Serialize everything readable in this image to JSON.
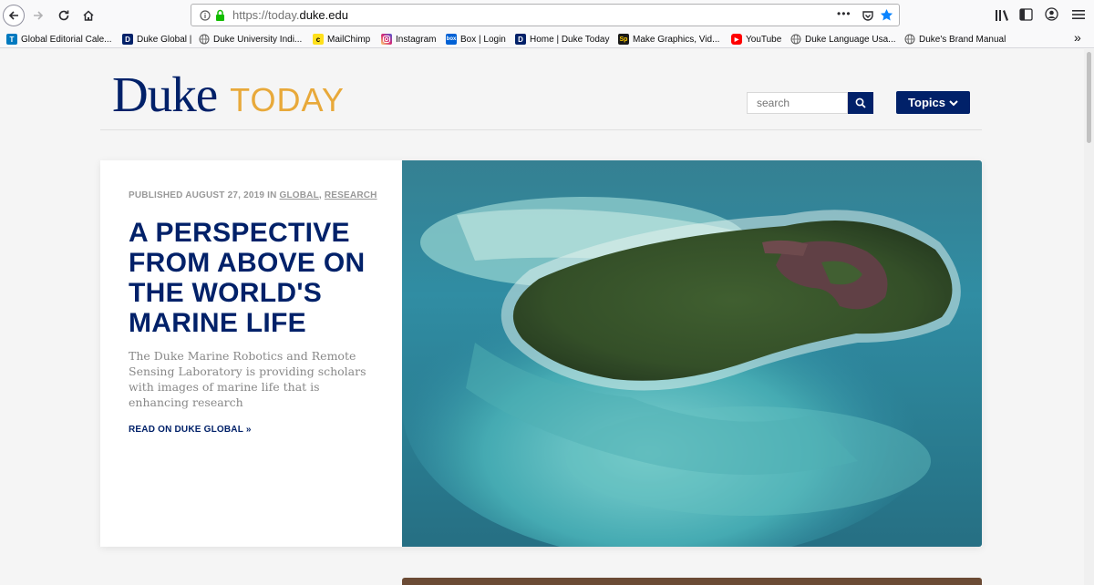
{
  "browser": {
    "url_prefix": "https://today.",
    "url_domain": "duke.edu",
    "menu_dots": "•••",
    "overflow_chevrons": "»"
  },
  "bookmarks": [
    {
      "label": "Global Editorial Cale...",
      "fav": "T",
      "color": "#0079bf"
    },
    {
      "label": "Duke Global |",
      "fav": "D",
      "color": "#012169"
    },
    {
      "label": "Duke University Indi...",
      "fav": "",
      "color": ""
    },
    {
      "label": "MailChimp",
      "fav": "c",
      "color": "#ffe01b"
    },
    {
      "label": "Instagram",
      "fav": "",
      "color": "#c13584"
    },
    {
      "label": "Box | Login",
      "fav": "box",
      "color": "#0061d5"
    },
    {
      "label": "Home | Duke Today",
      "fav": "D",
      "color": "#012169"
    },
    {
      "label": "Make Graphics, Vid...",
      "fav": "Sp",
      "color": "#1a1a1a"
    },
    {
      "label": "YouTube",
      "fav": "▶",
      "color": "#ff0000"
    },
    {
      "label": "Duke Language Usa...",
      "fav": "",
      "color": ""
    },
    {
      "label": "Duke's Brand Manual",
      "fav": "",
      "color": ""
    }
  ],
  "site": {
    "logo_main": "Duke",
    "logo_sub": "TODAY",
    "search_placeholder": "search",
    "topics_label": "Topics"
  },
  "article": {
    "meta_prefix": "PUBLISHED AUGUST 27, 2019 IN",
    "category_1": "GLOBAL",
    "meta_sep": ",",
    "category_2": "RESEARCH",
    "headline": "A PERSPECTIVE FROM ABOVE ON THE WORLD'S MARINE LIFE",
    "summary": "The Duke Marine Robotics and Remote Sensing Laboratory is providing scholars with images of marine life that is enhancing research",
    "read_more": "READ ON DUKE GLOBAL »"
  },
  "colors": {
    "duke_blue": "#012169",
    "today_gold": "#e8a93a"
  }
}
